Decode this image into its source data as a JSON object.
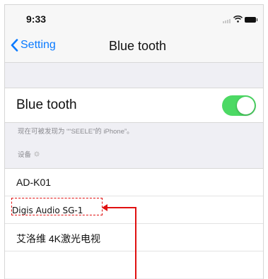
{
  "status_bar": {
    "time": "9:33"
  },
  "nav": {
    "back_label": "Setting",
    "title": "Blue tooth"
  },
  "bluetooth": {
    "label": "Blue tooth",
    "enabled": true,
    "discoverable_note": "现在可被发现为 ““SEELE”的 iPhone”。"
  },
  "devices": {
    "header": "设备",
    "items": [
      "AD-K01",
      "Digis Audio SG-1",
      "艾洛维 4K激光电视"
    ]
  },
  "colors": {
    "accent": "#0a7aff",
    "toggle_on": "#4cd964",
    "annotation": "#e01010"
  }
}
